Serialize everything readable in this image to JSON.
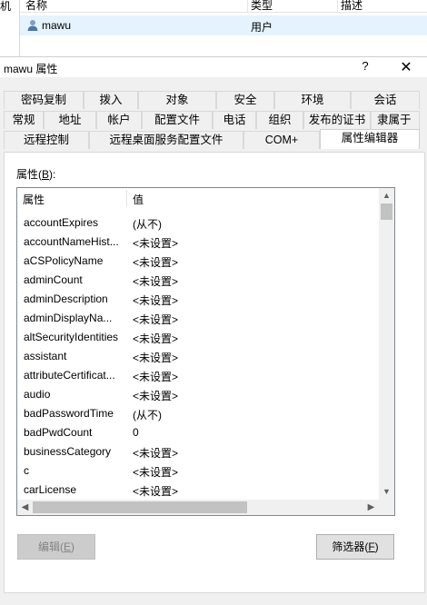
{
  "background_window": {
    "left_edge_text": "机",
    "columns": [
      "名称",
      "类型",
      "描述"
    ],
    "row": {
      "name": "mawu",
      "type": "用户",
      "icon": "user-icon"
    }
  },
  "dialog": {
    "title": "mawu 属性",
    "help": "?",
    "close": "✕"
  },
  "tabs": {
    "row1": [
      "密码复制",
      "拨入",
      "对象",
      "安全",
      "环境",
      "会话"
    ],
    "row2": [
      "常规",
      "地址",
      "帐户",
      "配置文件",
      "电话",
      "组织",
      "发布的证书",
      "隶属于"
    ],
    "row3": [
      "远程控制",
      "远程桌面服务配置文件",
      "COM+",
      "属性编辑器"
    ],
    "active": "属性编辑器"
  },
  "attributes_label_prefix": "属性(",
  "attributes_label_key": "B",
  "attributes_label_suffix": "):",
  "list": {
    "col_attr": "属性",
    "col_value": "值",
    "rows": [
      {
        "attr": "accountExpires",
        "value": "(从不)"
      },
      {
        "attr": "accountNameHist...",
        "value": "<未设置>"
      },
      {
        "attr": "aCSPolicyName",
        "value": "<未设置>"
      },
      {
        "attr": "adminCount",
        "value": "<未设置>"
      },
      {
        "attr": "adminDescription",
        "value": "<未设置>"
      },
      {
        "attr": "adminDisplayNa...",
        "value": "<未设置>"
      },
      {
        "attr": "altSecurityIdentities",
        "value": "<未设置>"
      },
      {
        "attr": "assistant",
        "value": "<未设置>"
      },
      {
        "attr": "attributeCertificat...",
        "value": "<未设置>"
      },
      {
        "attr": "audio",
        "value": "<未设置>"
      },
      {
        "attr": "badPasswordTime",
        "value": "(从不)"
      },
      {
        "attr": "badPwdCount",
        "value": "0"
      },
      {
        "attr": "businessCategory",
        "value": "<未设置>"
      },
      {
        "attr": "c",
        "value": "<未设置>"
      },
      {
        "attr": "carLicense",
        "value": "<未设置>"
      }
    ]
  },
  "buttons": {
    "edit": {
      "text": "编辑(",
      "key": "E",
      "end": ")"
    },
    "filter": {
      "text": "筛选器(",
      "key": "F",
      "end": ")"
    }
  }
}
